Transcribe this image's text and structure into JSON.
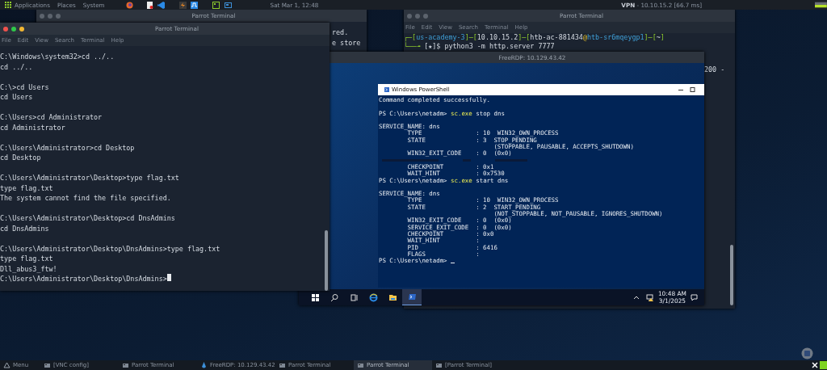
{
  "top_panel": {
    "menus": [
      "Applications",
      "Places",
      "System"
    ],
    "clock": "Sat Mar 1, 12:48",
    "vpn": "**VPN** - 10.10.15.2 [66.7 ms]"
  },
  "terminals": [
    {
      "title": "Parrot Terminal",
      "focused": false,
      "lines": [
        "red.",
        "e store"
      ]
    },
    {
      "title": "Parrot Terminal",
      "focused": false,
      "menu": [
        "File",
        "Edit",
        "View",
        "Search",
        "Terminal",
        "Help"
      ],
      "prompt": [
        {
          "text": "┌─[",
          "kind": "frame"
        },
        {
          "text": "us-academy-3",
          "kind": "label"
        },
        {
          "text": "]─[",
          "kind": "frame"
        },
        {
          "text": "10.10.15.2",
          "kind": "plain"
        },
        {
          "text": "]─[",
          "kind": "frame"
        },
        {
          "text": "htb-ac-881434",
          "kind": "plain"
        },
        {
          "text": "@",
          "kind": "at"
        },
        {
          "text": "htb-sr6mqeygp1",
          "kind": "label"
        },
        {
          "text": "]─[",
          "kind": "frame"
        },
        {
          "text": "~",
          "kind": "plain"
        },
        {
          "text": "]",
          "kind": "frame"
        }
      ],
      "command": [
        {
          "text": "└──╼ ",
          "kind": "frame"
        },
        {
          "text": "[★]$ python3 -m http.server 7777",
          "kind": "plain"
        }
      ],
      "output": "200 -",
      "scrollbar": true
    },
    {
      "title": "Parrot Terminal",
      "focused": true,
      "menu": [
        "File",
        "Edit",
        "View",
        "Search",
        "Terminal",
        "Help"
      ],
      "blocks": [
        [
          "C:\\Windows\\system32>cd ../..",
          "cd ../.."
        ],
        [
          "C:\\>cd Users",
          "cd Users"
        ],
        [
          "C:\\Users>cd Administrator",
          "cd Administrator"
        ],
        [
          "C:\\Users\\Administrator>cd Desktop",
          "cd Desktop"
        ],
        [
          "C:\\Users\\Administrator\\Desktop>type flag.txt",
          "type flag.txt",
          "The system cannot find the file specified."
        ],
        [
          "C:\\Users\\Administrator\\Desktop>cd DnsAdmins",
          "cd DnsAdmins"
        ],
        [
          "C:\\Users\\Administrator\\Desktop\\DnsAdmins>type flag.txt",
          "type flag.txt",
          "Dll_abus3_ftw!",
          "C:\\Users\\Administrator\\Desktop\\DnsAdmins>"
        ]
      ],
      "cursor": true,
      "scrollbar": true
    }
  ],
  "rdp": {
    "title": "FreeRDP: 10.129.43.42",
    "powershell": {
      "title": "Windows PowerShell",
      "blocks": [
        [
          {
            "text": "Command completed successfully."
          }
        ],
        [
          {
            "prompt": "PS C:\\Users\\netadm>",
            "command": "sc.exe",
            "args": "stop dns"
          }
        ],
        [
          {
            "text": "SERVICE_NAME: dns"
          },
          {
            "text": "        TYPE               : 10  WIN32_OWN_PROCESS"
          },
          {
            "text": "        STATE              : 3  STOP_PENDING"
          },
          {
            "text": "                                (STOPPABLE, PAUSABLE, ACCEPTS_SHUTDOWN)"
          },
          {
            "text": "        WIN32_EXIT_CODE    : 0  (0x0)"
          },
          {
            "kind": "garbled"
          },
          {
            "text": "        CHECKPOINT         : 0x1"
          },
          {
            "text": "        WAIT_HINT          : 0x7530"
          },
          {
            "prompt": "PS C:\\Users\\netadm>",
            "command": "sc.exe",
            "args": "start dns"
          }
        ],
        [
          {
            "text": "SERVICE_NAME: dns"
          },
          {
            "text": "        TYPE               : 10  WIN32_OWN_PROCESS"
          },
          {
            "text": "        STATE              : 2  START_PENDING"
          },
          {
            "text": "                                (NOT_STOPPABLE, NOT_PAUSABLE, IGNORES_SHUTDOWN)"
          },
          {
            "text": "        WIN32_EXIT_CODE    : 0  (0x0)"
          },
          {
            "text": "        SERVICE_EXIT_CODE  : 0  (0x0)"
          },
          {
            "text": "        CHECKPOINT         : 0x0"
          },
          {
            "text": "        WAIT_HINT          :"
          },
          {
            "text": "        PID                : 6416"
          },
          {
            "text": "        FLAGS              :"
          },
          {
            "prompt": "PS C:\\Users\\netadm>",
            "cursor": true
          }
        ]
      ]
    },
    "taskbar": {
      "apps": [
        {
          "kind": "start",
          "selected": false
        },
        {
          "kind": "search",
          "selected": false
        },
        {
          "kind": "taskview",
          "selected": false
        },
        {
          "kind": "browser",
          "selected": false
        },
        {
          "kind": "folder",
          "selected": false
        },
        {
          "kind": "shell",
          "selected": true
        }
      ],
      "time": "10:48 AM",
      "date": "3/1/2025"
    }
  },
  "bottom_panel": {
    "items": [
      {
        "label": "Menu",
        "kind": "menu",
        "selected": false
      },
      {
        "label": "[VNC config]",
        "kind": "window",
        "selected": false
      },
      {
        "label": "Parrot Terminal",
        "kind": "window",
        "selected": false
      },
      {
        "label": "FreeRDP: 10.129.43.42",
        "kind": "remote",
        "selected": false
      },
      {
        "label": "Parrot Terminal",
        "kind": "window",
        "selected": false
      },
      {
        "label": "Parrot Terminal",
        "kind": "window",
        "selected": true
      },
      {
        "label": "[Parrot Terminal]",
        "kind": "window",
        "selected": false
      }
    ]
  }
}
